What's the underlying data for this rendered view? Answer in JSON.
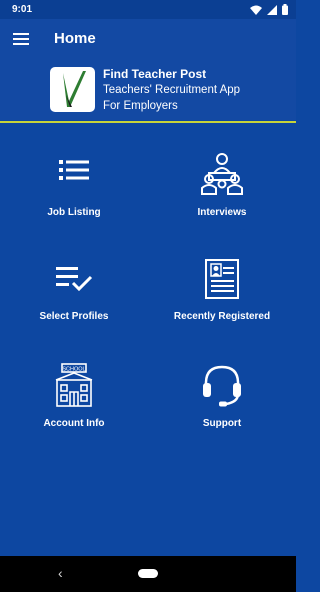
{
  "status_bar": {
    "time": "9:01",
    "icons": [
      "wifi-icon",
      "signal-icon",
      "battery-icon"
    ]
  },
  "app_bar": {
    "title": "Home",
    "menu_icon": "hamburger-menu-icon"
  },
  "header": {
    "title": "Find Teacher Post",
    "subtitle_line1": "Teachers' Recruitment App",
    "subtitle_line2": "For Employers"
  },
  "tiles": [
    {
      "label": "Job Listing",
      "icon": "list-icon"
    },
    {
      "label": "Interviews",
      "icon": "interview-meeting-icon"
    },
    {
      "label": "Select Profiles",
      "icon": "checklist-icon"
    },
    {
      "label": "Recently Registered",
      "icon": "id-card-icon"
    },
    {
      "label": "Account Info",
      "icon": "school-building-icon"
    },
    {
      "label": "Support",
      "icon": "headset-icon"
    }
  ],
  "nav_bar": {
    "back_icon": "back-chevron-icon",
    "home_icon": "home-pill-icon"
  },
  "colors": {
    "background": "#0d47a1",
    "app_bar": "#1349a3",
    "accent_line": "#c6d43a",
    "logo_check": "#2e7d32"
  }
}
